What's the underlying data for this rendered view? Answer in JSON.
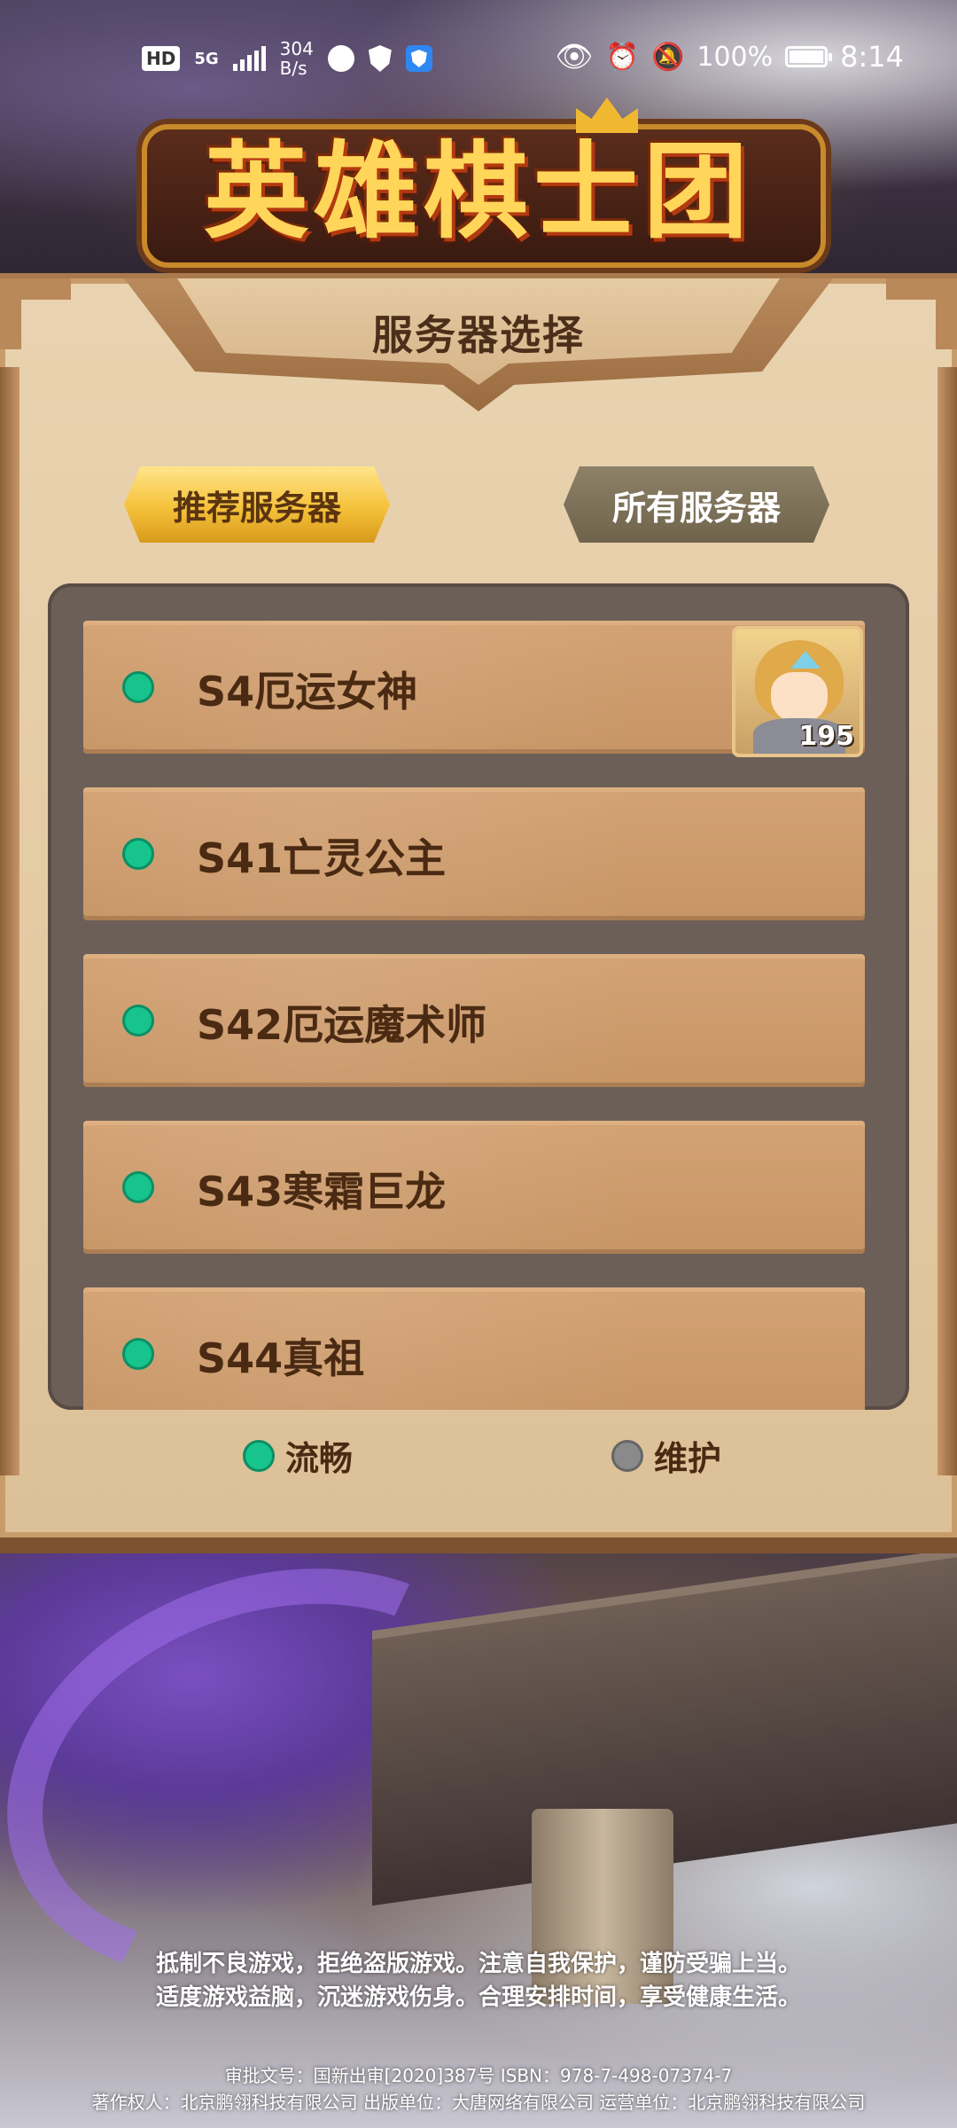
{
  "status_bar": {
    "hd": "HD",
    "network": "5G",
    "net_speed_value": "304",
    "net_speed_unit": "B/s",
    "battery": "100%",
    "time": "8:14"
  },
  "logo": {
    "text": "英雄棋士团"
  },
  "dialog": {
    "title": "服务器选择",
    "tabs": [
      {
        "label": "推荐服务器",
        "selected": true
      },
      {
        "label": "所有服务器",
        "selected": false
      }
    ],
    "servers": [
      {
        "name": "S4厄运女神",
        "status": "流畅",
        "hero_level": "195"
      },
      {
        "name": "S41亡灵公主",
        "status": "流畅"
      },
      {
        "name": "S42厄运魔术师",
        "status": "流畅"
      },
      {
        "name": "S43寒霜巨龙",
        "status": "流畅"
      },
      {
        "name": "S44真祖",
        "status": "流畅"
      }
    ],
    "legend": [
      {
        "label": "流畅",
        "color": "#17c48c"
      },
      {
        "label": "维护",
        "color": "#8a8a8a"
      }
    ]
  },
  "notice": {
    "line1": "抵制不良游戏，拒绝盗版游戏。注意自我保护，谨防受骗上当。",
    "line2": "适度游戏益脑，沉迷游戏伤身。合理安排时间，享受健康生活。"
  },
  "copyright": {
    "line1": "审批文号：国新出审[2020]387号 ISBN：978-7-498-07374-7",
    "line2": "著作权人：北京鹏翎科技有限公司 出版单位：大唐网络有限公司 运营单位：北京鹏翎科技有限公司"
  }
}
